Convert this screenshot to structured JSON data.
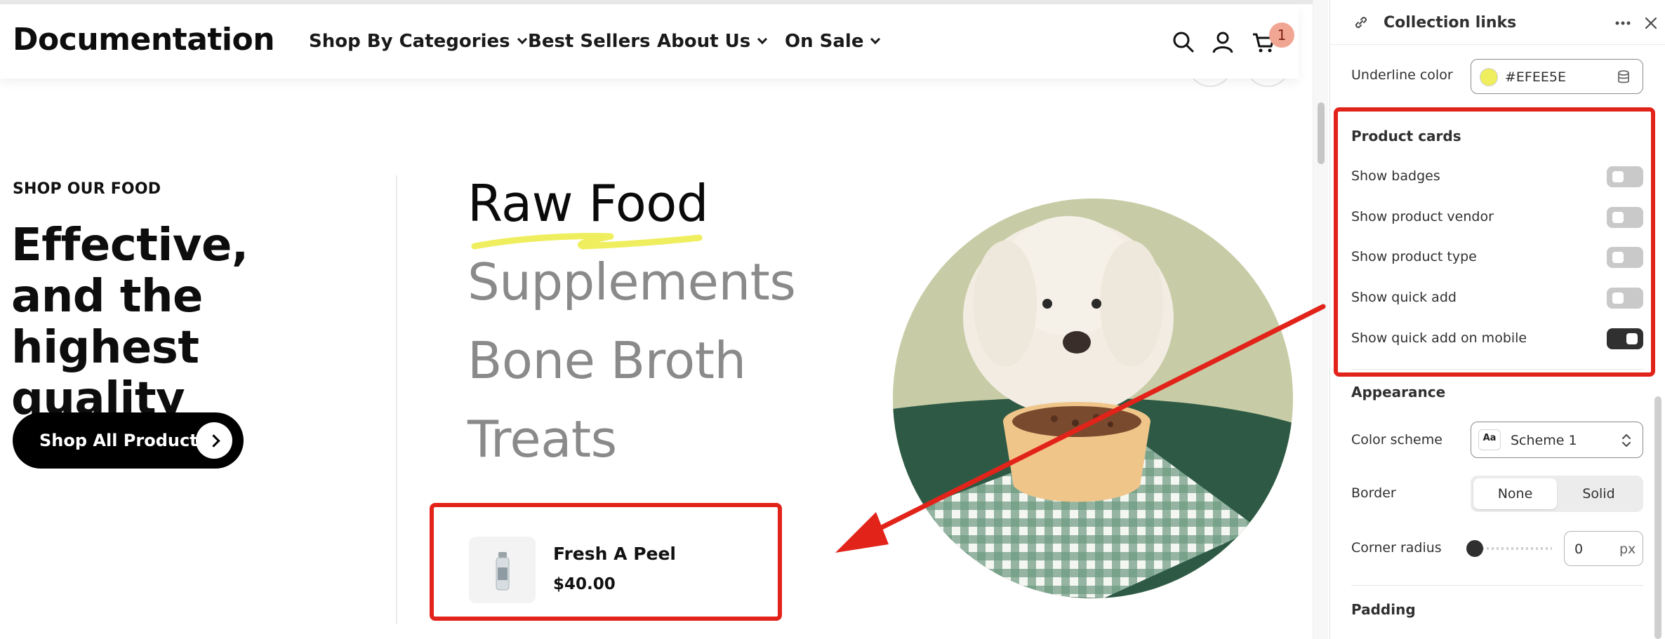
{
  "store": {
    "logo": "Documentation",
    "nav": [
      {
        "label": "Shop By Categories",
        "dropdown": true
      },
      {
        "label": "Best Sellers",
        "dropdown": false
      },
      {
        "label": "About Us",
        "dropdown": true
      },
      {
        "label": "On Sale",
        "dropdown": true
      }
    ],
    "cart_count": "1",
    "icons": [
      "search-icon",
      "account-icon",
      "cart-icon"
    ]
  },
  "hero": {
    "eyebrow": "SHOP OUR FOOD",
    "headline": "Effective, and the highest quality",
    "cta_label": "Shop All Products",
    "categories": [
      {
        "label": "Raw Food",
        "active": true
      },
      {
        "label": "Supplements",
        "active": false
      },
      {
        "label": "Bone Broth",
        "active": false
      },
      {
        "label": "Treats",
        "active": false
      }
    ],
    "product": {
      "name": "Fresh A Peel",
      "price": "$40.00"
    }
  },
  "panel": {
    "title": "Collection links",
    "underline_color": {
      "label": "Underline color",
      "value": "#EFEE5E"
    },
    "product_cards": {
      "title": "Product cards",
      "toggles": [
        {
          "label": "Show badges",
          "on": false
        },
        {
          "label": "Show product vendor",
          "on": false
        },
        {
          "label": "Show product type",
          "on": false
        },
        {
          "label": "Show quick add",
          "on": false
        },
        {
          "label": "Show quick add on mobile",
          "on": true
        }
      ]
    },
    "appearance": {
      "title": "Appearance",
      "color_scheme_label": "Color scheme",
      "color_scheme_chip": "Aa",
      "color_scheme_value": "Scheme 1",
      "border_label": "Border",
      "border_options": [
        "None",
        "Solid"
      ],
      "border_selected": "None",
      "corner_radius_label": "Corner radius",
      "corner_radius_value": "0",
      "corner_radius_unit": "px"
    },
    "padding_title": "Padding"
  },
  "colors": {
    "accent_underline": "#EFEE5E",
    "annotation_red": "#e2231a",
    "cart_badge": "#f1a693"
  }
}
